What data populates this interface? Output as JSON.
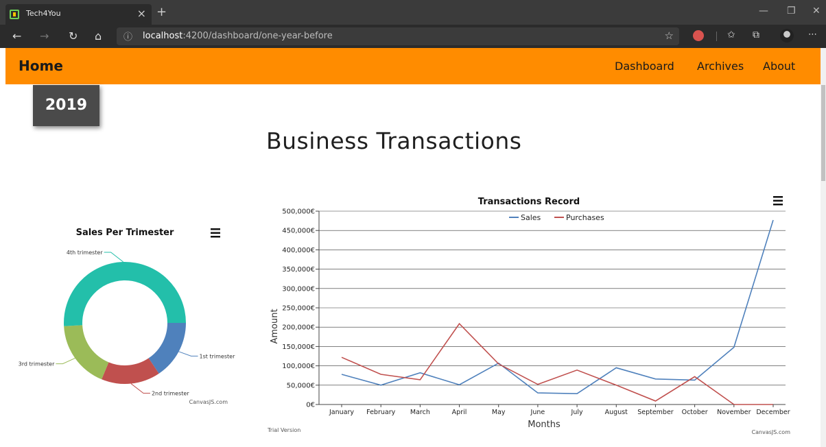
{
  "browser": {
    "tab_title": "Tech4You",
    "tab_close": "×",
    "new_tab": "+",
    "url_prefix": "localhost",
    "url_rest": ":4200/dashboard/one-year-before",
    "icons": {
      "back": "back-arrow-icon",
      "forward": "forward-arrow-icon",
      "refresh": "refresh-icon",
      "home": "home-icon",
      "info": "info-icon",
      "favorite": "star-icon",
      "favorites": "favorites-icon",
      "collections": "collections-icon",
      "more": "more-icon"
    }
  },
  "navbar": {
    "home": "Home",
    "links": [
      "Dashboard",
      "Archives",
      "About"
    ],
    "accent": "#ff8c00"
  },
  "year": "2019",
  "page_title": "Business Transactions",
  "chart_data": [
    {
      "type": "pie",
      "title": "Sales Per Trimester",
      "labels": [
        "1st trimester",
        "2nd trimester",
        "3rd trimester",
        "4th trimester"
      ],
      "values": [
        211000,
        212000,
        243000,
        689000
      ],
      "colors": [
        "#4f81bc",
        "#c0504e",
        "#9bbb58",
        "#23bfaa"
      ],
      "credit": "CanvasJS.com"
    },
    {
      "type": "line",
      "title": "Transactions Record",
      "xlabel": "Months",
      "ylabel": "Amount",
      "categories": [
        "January",
        "February",
        "March",
        "April",
        "May",
        "June",
        "July",
        "August",
        "September",
        "October",
        "November",
        "December"
      ],
      "y_ticks": [
        "0€",
        "50,000€",
        "100,000€",
        "150,000€",
        "200,000€",
        "250,000€",
        "300,000€",
        "350,000€",
        "400,000€",
        "450,000€",
        "500,000€"
      ],
      "ylim": [
        0,
        500000
      ],
      "grid": true,
      "legend": "top",
      "series": [
        {
          "name": "Sales",
          "color": "#4f81bc",
          "values": [
            78000,
            50000,
            82000,
            51000,
            107000,
            30000,
            28000,
            95000,
            66000,
            63000,
            148000,
            477000
          ]
        },
        {
          "name": "Purchases",
          "color": "#c0504e",
          "values": [
            122000,
            78000,
            64000,
            209000,
            105000,
            52000,
            89000,
            50000,
            9000,
            72000,
            0,
            0
          ]
        }
      ],
      "footer_left": "Trial Version",
      "credit": "CanvasJS.com"
    }
  ]
}
